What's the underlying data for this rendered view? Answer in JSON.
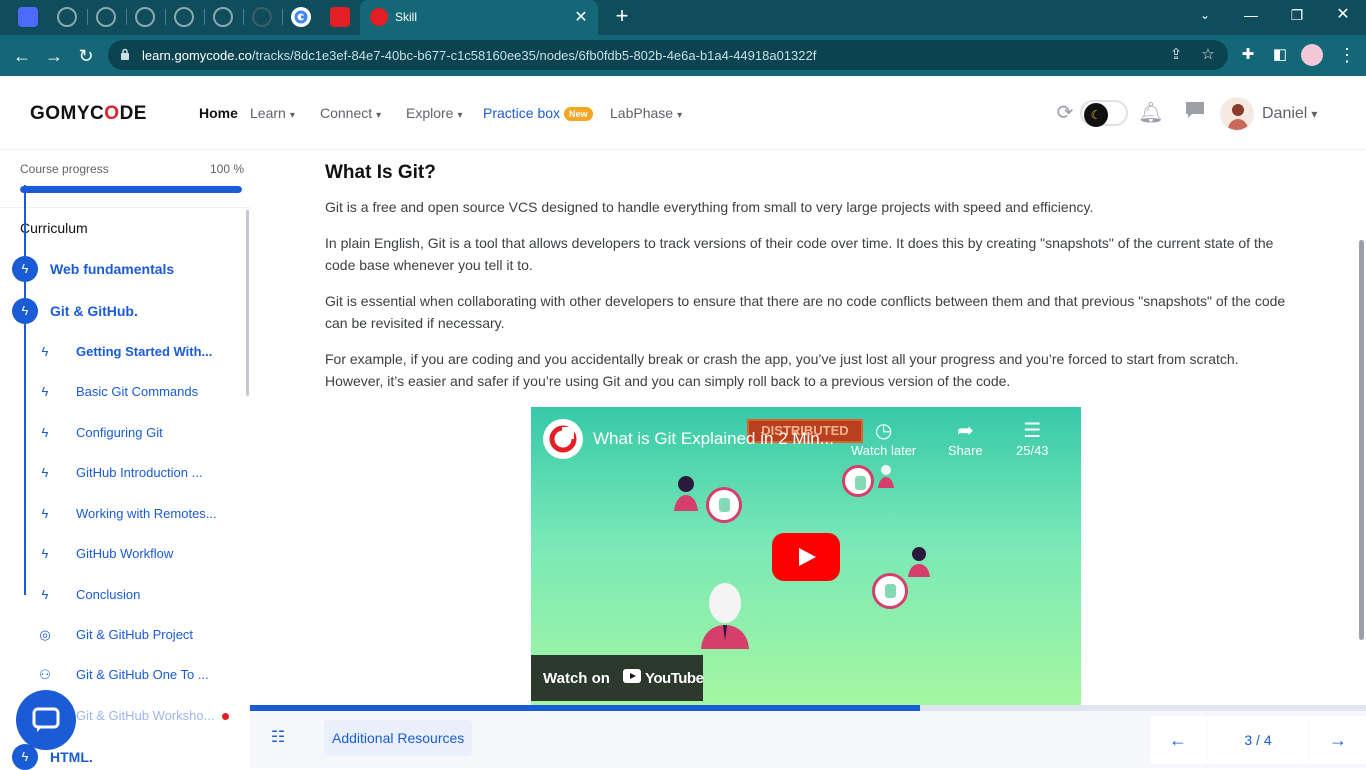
{
  "browser": {
    "active_tab_title": "Skill",
    "url_domain": "learn.gomycode.co",
    "url_path": "/tracks/8dc1e3ef-84e7-40bc-b677-c1c58160ee35/nodes/6fb0fdb5-802b-4e6a-b1a4-44918a01322f"
  },
  "header": {
    "logo": "GOMYCODE",
    "nav": {
      "home": "Home",
      "learn": "Learn",
      "connect": "Connect",
      "explore": "Explore",
      "practice": "Practice box",
      "practice_badge": "New",
      "labphase": "LabPhase"
    },
    "username": "Daniel"
  },
  "sidebar": {
    "progress_label": "Course progress",
    "progress_value": "100 %",
    "progress_fraction": 1.0,
    "curriculum_title": "Curriculum",
    "sections": [
      {
        "label": "Web fundamentals"
      },
      {
        "label": "Git & GitHub."
      },
      {
        "label": "HTML."
      }
    ],
    "lessons": [
      {
        "label": "Getting Started With...",
        "icon": "bolt-icon"
      },
      {
        "label": "Basic Git Commands",
        "icon": "bolt-icon"
      },
      {
        "label": "Configuring Git",
        "icon": "bolt-icon"
      },
      {
        "label": "GitHub Introduction ...",
        "icon": "bolt-icon"
      },
      {
        "label": "Working with Remotes...",
        "icon": "bolt-icon"
      },
      {
        "label": "GitHub Workflow",
        "icon": "bolt-icon"
      },
      {
        "label": "Conclusion",
        "icon": "bolt-icon"
      },
      {
        "label": "Git & GitHub Project",
        "icon": "target-icon"
      },
      {
        "label": "Git & GitHub One To ...",
        "icon": "people-icon"
      },
      {
        "label": "Git & GitHub Worksho...",
        "icon": "bolt-icon"
      }
    ]
  },
  "main": {
    "title": "What Is Git?",
    "paragraphs": [
      "Git is a free and open source VCS designed to handle everything from small to very large projects with speed and efficiency.",
      "In plain English, Git is a tool that allows developers to track versions of their code over time. It does this by creating \"snapshots\" of the current state of the code base whenever you tell it to.",
      "Git is essential when collaborating with other developers to ensure that there are no code conflicts between them and that previous \"snapshots\" of the code can be revisited if necessary.",
      "For example, if you are coding and you accidentally break or crash the app, you’ve just lost all your progress and you’re forced to start from scratch. However, it’s easier and safer if you’re using Git and you can simply roll back to a previous version of the code."
    ],
    "video": {
      "title": "What is Git Explained in 2 Min...",
      "tag": "DISTRIBUTED",
      "watch_later": "Watch later",
      "share": "Share",
      "playlist_count": "25/43",
      "watch_on": "Watch on",
      "youtube": "YouTube"
    }
  },
  "footer": {
    "lesson_progress_fraction": 0.6,
    "additional_resources": "Additional Resources",
    "pager": "3 / 4"
  },
  "colors": {
    "accent": "#1a5bd6",
    "brand_red": "#e31e24",
    "browser_frame": "#136777"
  }
}
